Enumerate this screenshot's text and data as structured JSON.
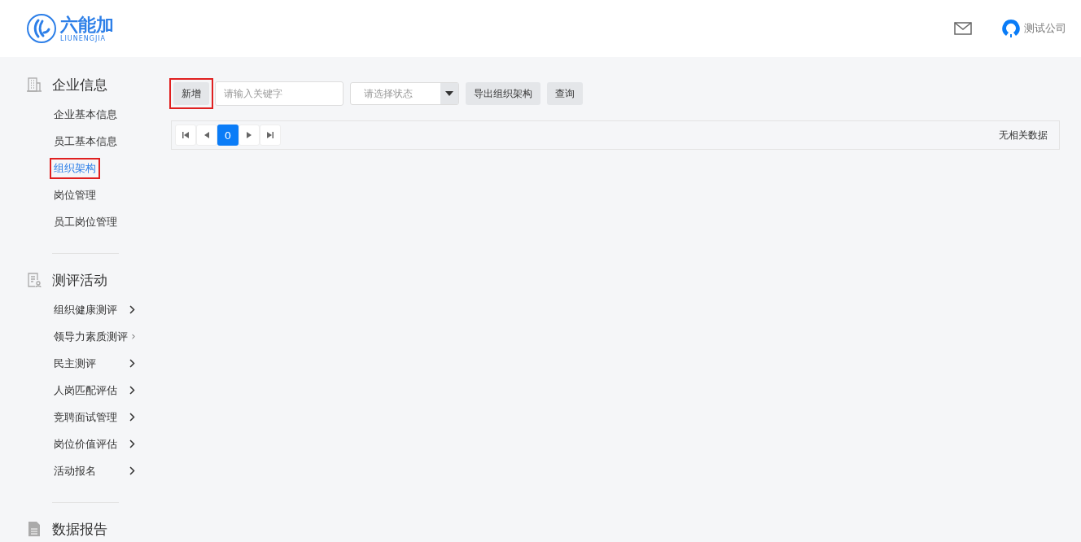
{
  "header": {
    "logo": {
      "name": "六能加",
      "subtitle": "LIUNENGJIA"
    },
    "user": "测试公司"
  },
  "sidebar": {
    "sections": [
      {
        "title": "企业信息",
        "kind": "building",
        "items": [
          {
            "label": "企业基本信息",
            "selected": false,
            "highlighted": false,
            "expandable": false
          },
          {
            "label": "员工基本信息",
            "selected": false,
            "highlighted": false,
            "expandable": false
          },
          {
            "label": "组织架构",
            "selected": true,
            "highlighted": true,
            "expandable": false
          },
          {
            "label": "岗位管理",
            "selected": false,
            "highlighted": false,
            "expandable": false
          },
          {
            "label": "员工岗位管理",
            "selected": false,
            "highlighted": false,
            "expandable": false
          }
        ]
      },
      {
        "title": "测评活动",
        "kind": "form",
        "items": [
          {
            "label": "组织健康测评",
            "selected": false,
            "highlighted": false,
            "expandable": true
          },
          {
            "label": "领导力素质测评",
            "selected": false,
            "highlighted": false,
            "expandable": true
          },
          {
            "label": "民主测评",
            "selected": false,
            "highlighted": false,
            "expandable": true
          },
          {
            "label": "人岗匹配评估",
            "selected": false,
            "highlighted": false,
            "expandable": true
          },
          {
            "label": "竞聘面试管理",
            "selected": false,
            "highlighted": false,
            "expandable": true
          },
          {
            "label": "岗位价值评估",
            "selected": false,
            "highlighted": false,
            "expandable": true
          },
          {
            "label": "活动报名",
            "selected": false,
            "highlighted": false,
            "expandable": true
          }
        ]
      },
      {
        "title": "数据报告",
        "kind": "document"
      }
    ]
  },
  "toolbar": {
    "add_button": {
      "label": "新增",
      "highlighted": true
    },
    "keyword": {
      "placeholder": "请输入关键字"
    },
    "status": {
      "placeholder": "请选择状态"
    },
    "export_button": "导出组织架构",
    "query_button": "查询"
  },
  "pager": {
    "current": "0",
    "message": "无相关数据"
  }
}
